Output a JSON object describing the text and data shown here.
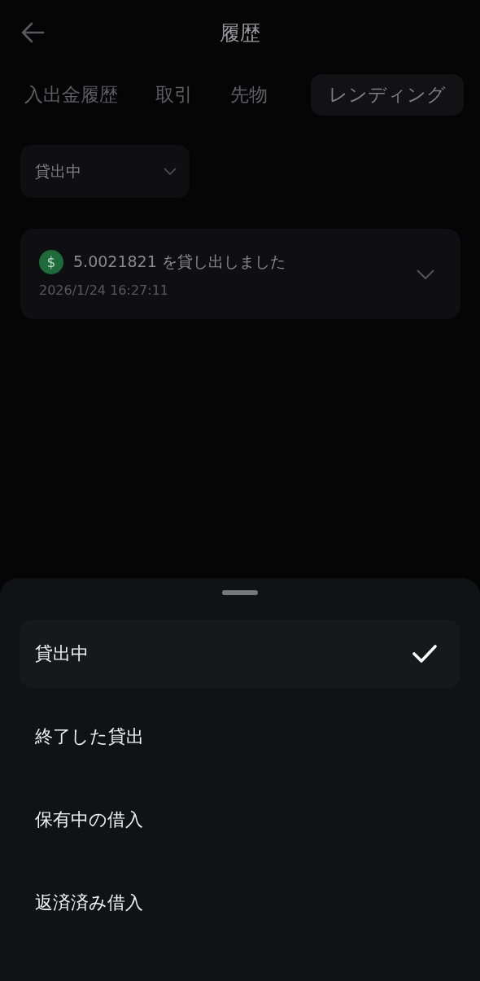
{
  "header": {
    "title": "履歴"
  },
  "tabs": [
    {
      "label": "入出金履歴",
      "selected": false
    },
    {
      "label": "取引",
      "selected": false
    },
    {
      "label": "先物",
      "selected": false
    },
    {
      "label": "レンディング",
      "selected": true
    }
  ],
  "filter": {
    "value": "貸出中"
  },
  "records": [
    {
      "title": "5.0021821 を貸し出しました",
      "time": "2026/1/24 16:27:11",
      "icon": "$"
    }
  ],
  "sheet": {
    "options": [
      {
        "label": "貸出中",
        "selected": true
      },
      {
        "label": "終了した貸出",
        "selected": false
      },
      {
        "label": "保有中の借入",
        "selected": false
      },
      {
        "label": "返済済み借入",
        "selected": false
      }
    ]
  }
}
